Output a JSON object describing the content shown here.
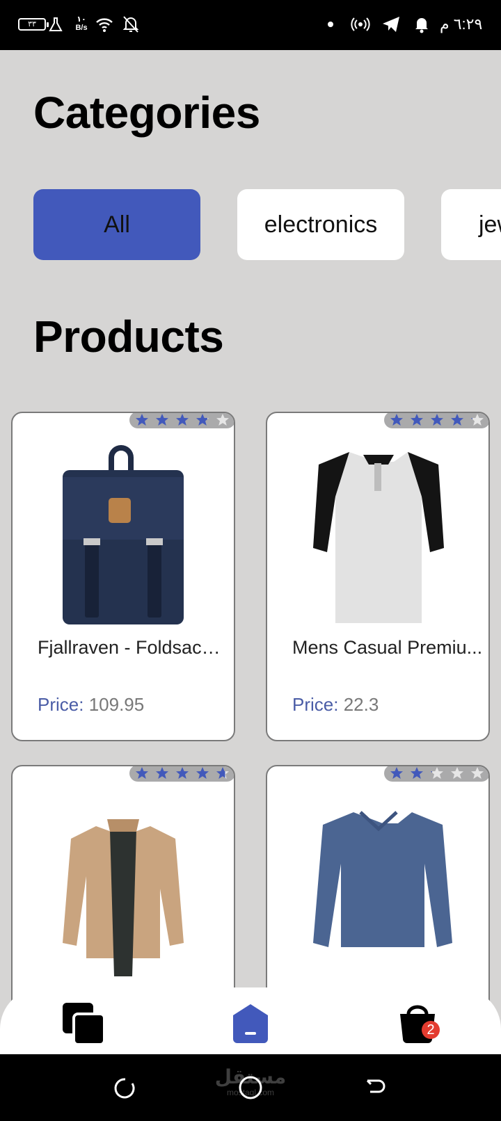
{
  "status_bar": {
    "time": "٦:٢٩ م",
    "battery": "٣٣",
    "net_speed_value": "١٠",
    "net_speed_unit": "B/s",
    "icons": [
      "battery-icon",
      "flask-icon",
      "wifi-icon",
      "bell-off-icon",
      "dot-icon",
      "hotspot-icon",
      "telegram-icon",
      "bell-icon"
    ]
  },
  "headings": {
    "categories": "Categories",
    "products": "Products"
  },
  "categories": [
    "All",
    "electronics",
    "jewelery"
  ],
  "selected_category": "All",
  "products": [
    {
      "name": "Fjallraven - Foldsack ...",
      "price_label": "Price:",
      "price": "109.95",
      "rating": 3.9
    },
    {
      "name": "Mens Casual Premiu...",
      "price_label": "Price:",
      "price": "22.3",
      "rating": 4.1
    },
    {
      "name": "",
      "price_label": "",
      "price": "",
      "rating": 4.7
    },
    {
      "name": "",
      "price_label": "",
      "price": "",
      "rating": 2.1
    }
  ],
  "bottom_nav": {
    "items": [
      "categories-icon",
      "home-icon",
      "cart-icon"
    ],
    "cart_count": "2"
  },
  "watermark": {
    "main": "مستقل",
    "sub": "mostaql.com"
  },
  "colors": {
    "accent": "#4259bb",
    "star": "#4259bb",
    "badge": "#e33b2f",
    "background": "#d6d5d4"
  }
}
